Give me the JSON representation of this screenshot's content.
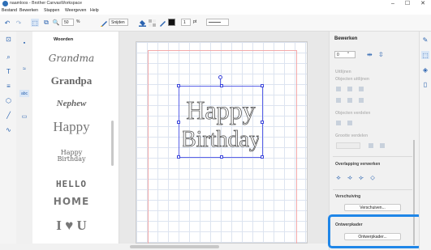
{
  "window": {
    "title": "naamloos - Brother CanvasWorkspace",
    "controls": {
      "minimize": "–",
      "maximize": "☐",
      "close": "✕"
    }
  },
  "menu": [
    "Bestand",
    "Bewerken",
    "Stappen",
    "Weergeven",
    "Help"
  ],
  "toolbar": {
    "undo_icon": "↶",
    "redo_icon": "↷",
    "select_icon": "⬚",
    "copy_icon": "⧉",
    "zoom_icon": "🔍",
    "zoom_value": "50",
    "zoom_unit": "%",
    "tool_label": "Snijden",
    "stroke_width": "1",
    "stroke_unit": "pt",
    "fill_color": "#111111"
  },
  "left_tools": [
    "⊡",
    "⌕",
    "T",
    "≡",
    "⬡",
    "╱",
    "∿"
  ],
  "categories": [
    "▪",
    "≈",
    "abc",
    "▭"
  ],
  "font_panel": {
    "header": "Woorden",
    "samples": [
      "Grandma",
      "Grandpa",
      "Nephew",
      "Happy",
      "Happy Birthday",
      "HELLO",
      "HOME",
      "I ♥ U"
    ]
  },
  "canvas": {
    "text_line1": "Happy",
    "text_line2": "Birthday"
  },
  "right_panel": {
    "title": "Bewerken",
    "rotation_value": "0",
    "rotation_unit": "°",
    "sections": {
      "uitlijnen": "Uitlijnen",
      "objecten_uitlijnen": "Objecten uitlijnen",
      "objecten_verdelen": "Objecten verdelen",
      "grootte_verdelen": "Grootte verdelen",
      "overlapping": "Overlapping verwerken",
      "verschuiving": "Verschuiving",
      "verschuiven_btn": "Verschuiven...",
      "ontwerpkader": "Ontwerpkader",
      "ontwerpkader_btn": "Ontwerpkader..."
    }
  },
  "colors": {
    "accent": "#2a63b0",
    "highlight": "#1f86e8",
    "selection": "#5b63e8",
    "margin": "#f3a9a9"
  }
}
